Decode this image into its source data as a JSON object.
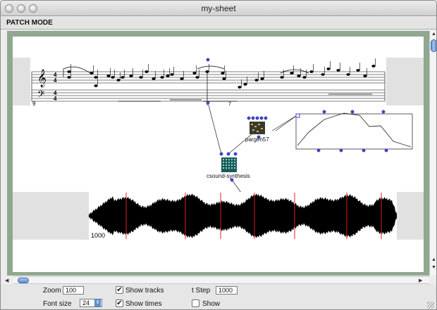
{
  "window": {
    "title": "my-sheet",
    "mode": "PATCH MODE"
  },
  "sheet": {
    "score": {
      "measure_number": "9",
      "tuplet_label": "7"
    },
    "pargen": {
      "label": "pargen57"
    },
    "csound": {
      "label": "csound-synthesis"
    },
    "sound": {
      "time_label": "1000"
    }
  },
  "controls": {
    "zoom_label": "Zoom",
    "zoom_value": "100",
    "fontsize_label": "Font size",
    "fontsize_value": "24",
    "show_tracks_label": "Show tracks",
    "show_tracks_checked": true,
    "show_times_label": "Show times",
    "show_times_checked": true,
    "tstep_label": "t Step",
    "tstep_value": "1000",
    "show_label": "Show",
    "show_checked": false
  },
  "colors": {
    "frame": "#8fa88f",
    "marker": "#e02020",
    "inlet": "#3d44d8",
    "waveform": "#000000"
  }
}
